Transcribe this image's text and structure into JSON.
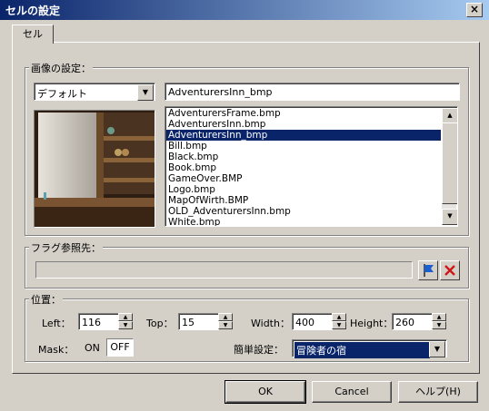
{
  "window": {
    "title": "セルの設定",
    "close_label": "×"
  },
  "tabs": [
    {
      "label": "セル"
    }
  ],
  "image_settings": {
    "group_label": "画像の設定：",
    "folder_combo": {
      "value": "デフォルト"
    },
    "filename_field": {
      "value": "AdventurersInn_bmp"
    },
    "files": [
      "AdventurersFrame.bmp",
      "AdventurersInn.bmp",
      "AdventurersInn_bmp",
      "Bill.bmp",
      "Black.bmp",
      "Book.bmp",
      "GameOver.BMP",
      "Logo.bmp",
      "MapOfWirth.BMP",
      "OLD_AdventurersInn.bmp",
      "White.bmp"
    ],
    "selected_index": 2
  },
  "flag": {
    "group_label": "フラグ参照先：",
    "field_value": ""
  },
  "position": {
    "group_label": "位置：",
    "left": {
      "label": "Left：",
      "value": "116"
    },
    "top": {
      "label": "Top：",
      "value": "15"
    },
    "width": {
      "label": "Width：",
      "value": "400"
    },
    "height": {
      "label": "Height：",
      "value": "260"
    },
    "mask": {
      "label": "Mask：",
      "on_label": "ON",
      "off_label": "OFF"
    },
    "preset": {
      "label": "簡単設定：",
      "value": "冒険者の宿"
    }
  },
  "buttons": {
    "ok": "OK",
    "cancel": "Cancel",
    "help": "ヘルプ(H)"
  },
  "colors": {
    "titlebar": "#0a246a",
    "selection": "#0a246a",
    "face": "#d4d0c8"
  },
  "icons": {
    "close": "close-icon",
    "flag": "flag-icon",
    "clear": "red-x-icon",
    "dropdown": "chevron-down-icon"
  }
}
